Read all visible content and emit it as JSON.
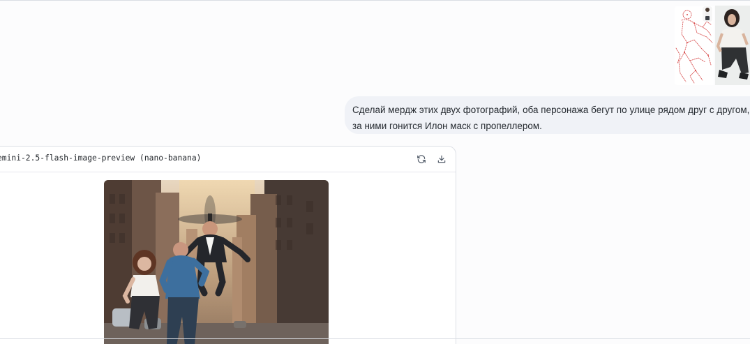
{
  "conversation": {
    "user_message": {
      "attachments": [
        {
          "icon": "pose-sketch-thumbnail"
        },
        {
          "icon": "woman-photo-thumbnail"
        }
      ],
      "lines": [
        "Сделай мердж этих двух фотографий, оба персонажа бегут по улице рядом друг с другом,",
        "за ними гонится Илон маск с пропеллером."
      ]
    },
    "model_response": {
      "model_name": "emini-2.5-flash-image-preview (nano-banana)",
      "actions": [
        {
          "icon": "refresh-icon"
        },
        {
          "icon": "download-icon"
        }
      ],
      "image": {
        "icon": "generated-image"
      }
    }
  },
  "colors": {
    "background": "#fcfcfd",
    "bubble": "#f0f2f7",
    "card_border": "#dcdfe5",
    "text": "#24292f",
    "icon": "#4b5563"
  }
}
